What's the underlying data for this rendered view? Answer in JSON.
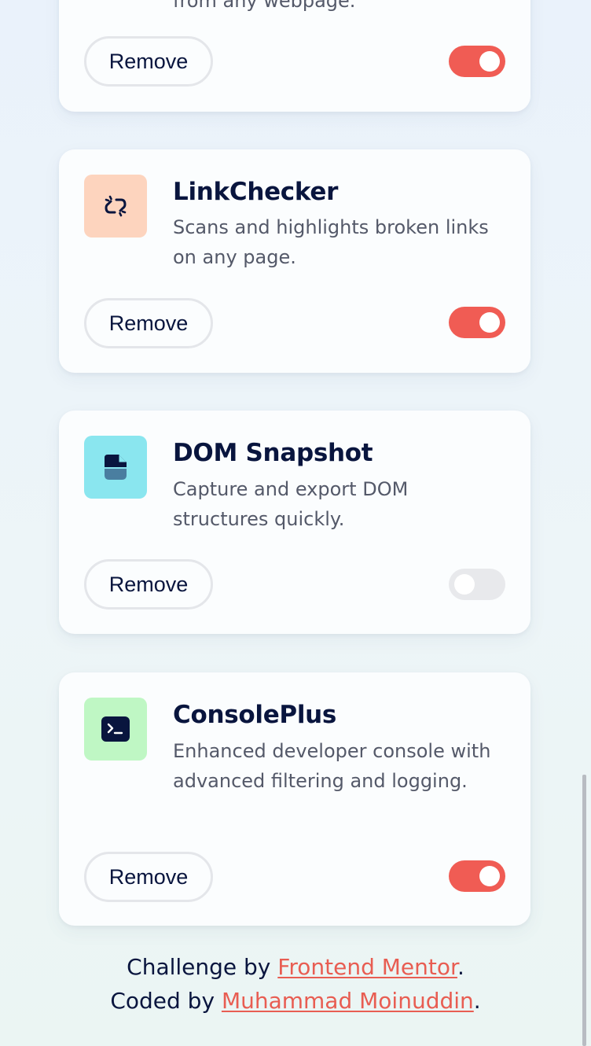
{
  "colors": {
    "accent": "#f05c54",
    "link": "#e85d52",
    "title": "#09153e",
    "description": "#545969",
    "toggle_off": "#e8e9ec"
  },
  "extensions": [
    {
      "name": "",
      "description": "from any webpage.",
      "icon": "partial-card-icon",
      "icon_bg": "",
      "remove_label": "Remove",
      "active": true
    },
    {
      "name": "LinkChecker",
      "description": "Scans and highlights broken links on any page.",
      "icon": "broken-link-icon",
      "icon_bg": "#fdd4be",
      "remove_label": "Remove",
      "active": true
    },
    {
      "name": "DOM Snapshot",
      "description": "Capture and export DOM structures quickly.",
      "icon": "snapshot-icon",
      "icon_bg": "#8ae6ef",
      "remove_label": "Remove",
      "active": false
    },
    {
      "name": "ConsolePlus",
      "description": "Enhanced developer console with advanced filtering and logging.",
      "icon": "terminal-icon",
      "icon_bg": "#bff7c4",
      "remove_label": "Remove",
      "active": true
    }
  ],
  "footer": {
    "line1_prefix": "Challenge by ",
    "line1_link": "Frontend Mentor",
    "line1_suffix": ".",
    "line2_prefix": "Coded by ",
    "line2_link": "Muhammad Moinuddin",
    "line2_suffix": "."
  }
}
